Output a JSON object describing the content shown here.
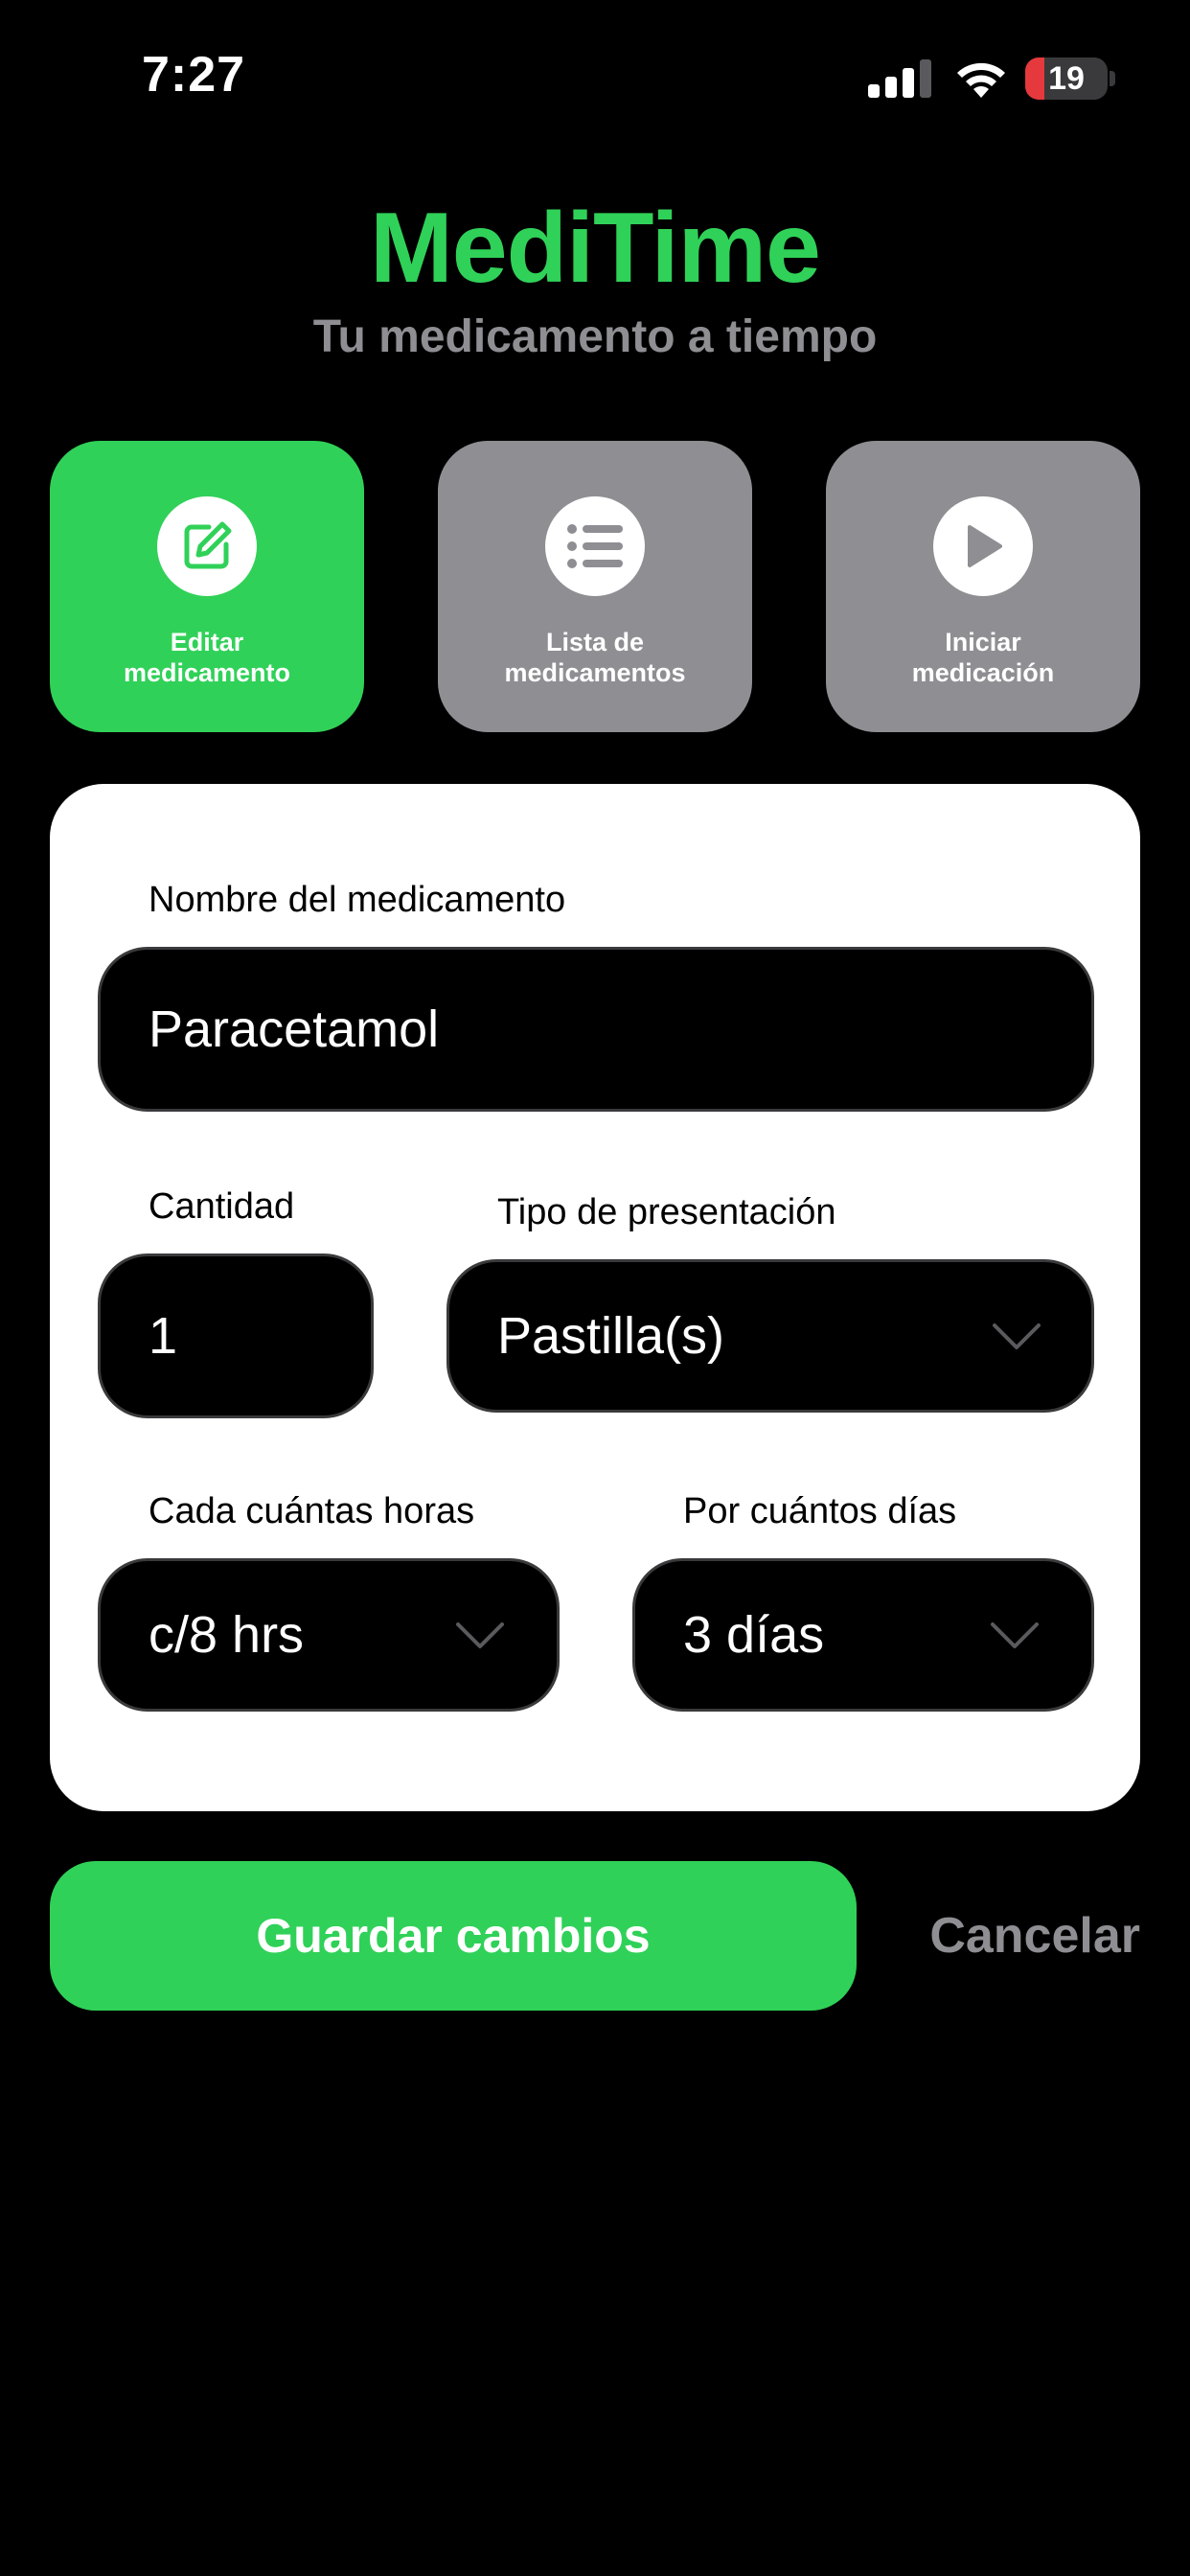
{
  "status_bar": {
    "time": "7:27",
    "battery_level": "19",
    "battery_color": "#e5393d"
  },
  "header": {
    "title": "MediTime",
    "subtitle": "Tu medicamento a tiempo"
  },
  "nav_tiles": [
    {
      "label": "Editar\nmedicamento",
      "icon": "edit-icon",
      "active": true
    },
    {
      "label": "Lista de\nmedicamentos",
      "icon": "list-icon",
      "active": false
    },
    {
      "label": "Iniciar\nmedicación",
      "icon": "play-icon",
      "active": false
    }
  ],
  "form": {
    "name_label": "Nombre del medicamento",
    "name_value": "Paracetamol",
    "quantity_label": "Cantidad",
    "quantity_value": "1",
    "presentation_label": "Tipo de presentación",
    "presentation_value": "Pastilla(s)",
    "interval_label": "Cada cuántas horas",
    "interval_value": "c/8 hrs",
    "duration_label": "Por cuántos días",
    "duration_value": "3 días"
  },
  "actions": {
    "save_label": "Guardar cambios",
    "cancel_label": "Cancelar"
  },
  "colors": {
    "accent": "#30d158",
    "inactive_tile": "#8e8e93",
    "background": "#000000",
    "card": "#ffffff"
  }
}
